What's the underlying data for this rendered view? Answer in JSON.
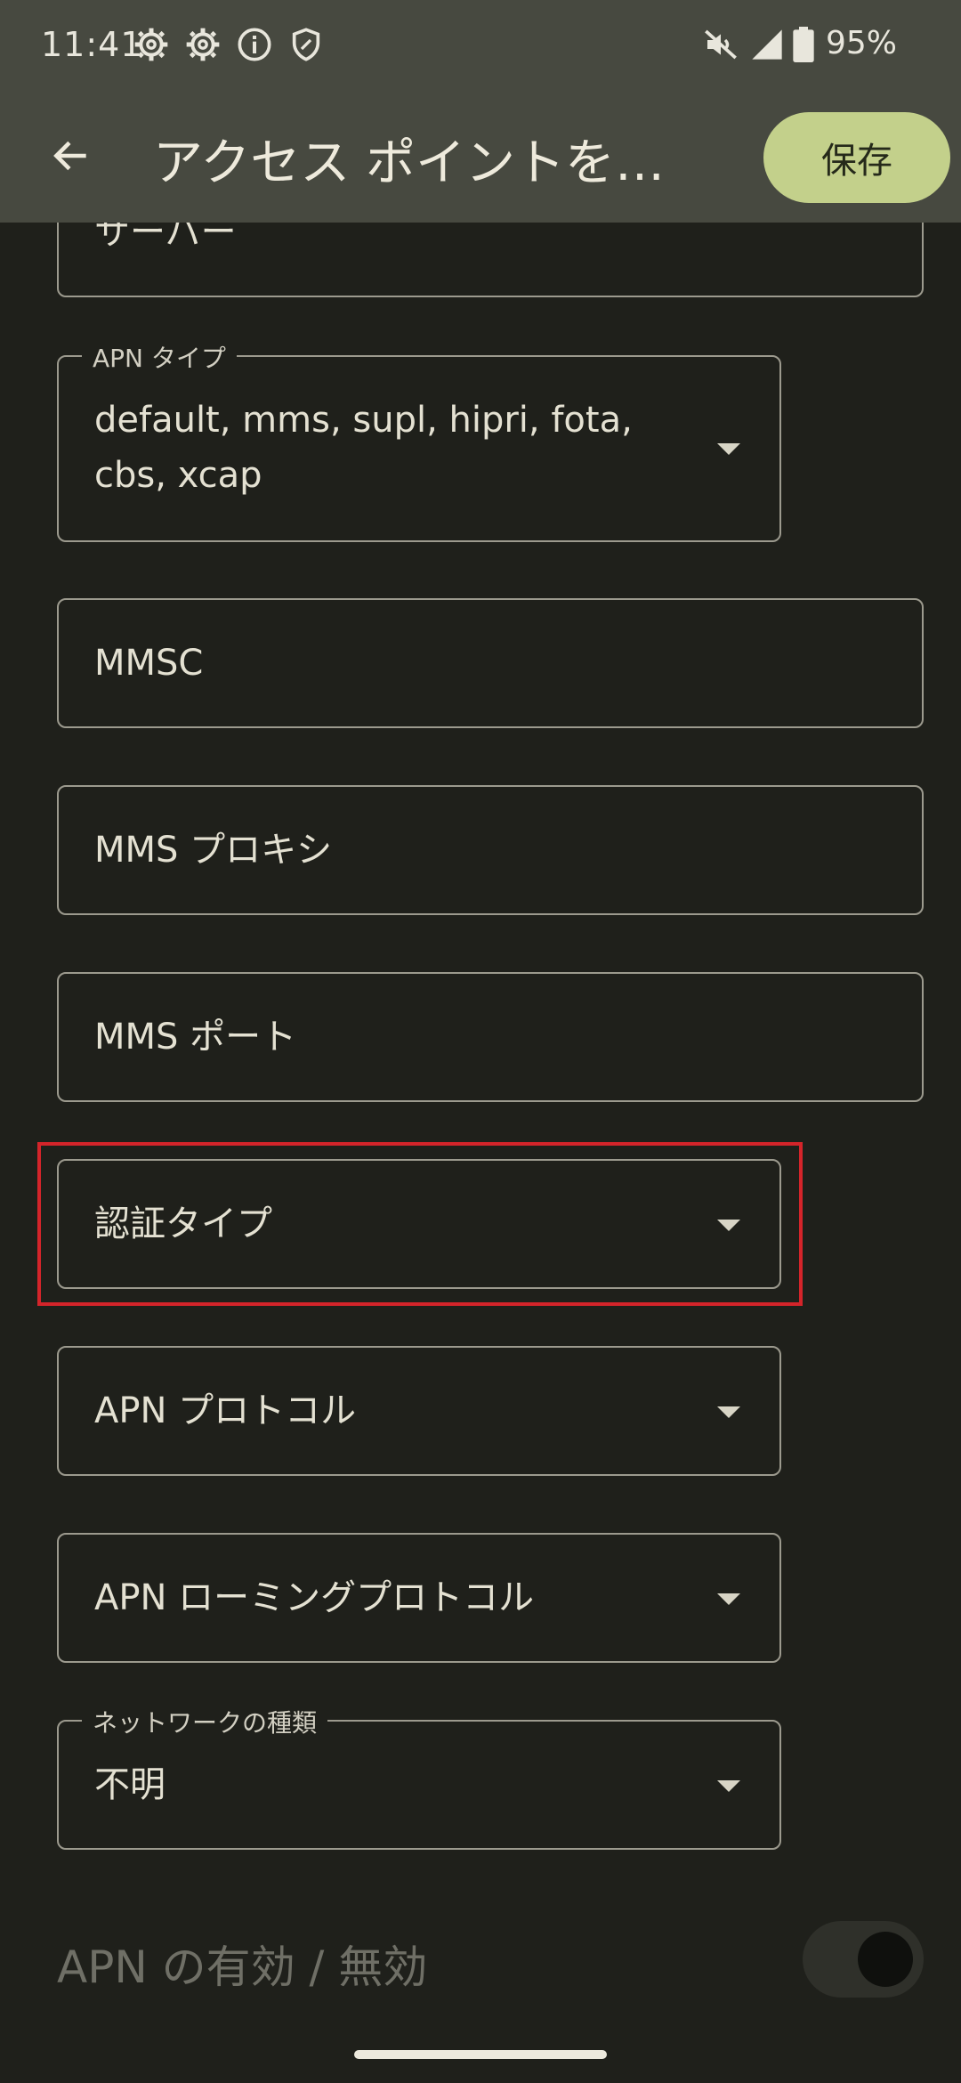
{
  "status_bar": {
    "time": "11:41",
    "left_icons": [
      "gear-icon",
      "gear-icon",
      "info-icon",
      "shield-icon"
    ],
    "right_icons": [
      "mute-icon",
      "signal-icon",
      "battery-icon"
    ],
    "battery": "95%"
  },
  "app_bar": {
    "back_icon": "arrow-left-icon",
    "title": "アクセス ポイントを…",
    "save_label": "保存"
  },
  "fields": {
    "server": {
      "text": "サーバー"
    },
    "apn_type": {
      "label": "APN タイプ",
      "line1": "default, mms, supl, hipri, fota,",
      "line2": "cbs, xcap"
    },
    "mmsc": {
      "text": "MMSC"
    },
    "mms_proxy": {
      "text": "MMS プロキシ"
    },
    "mms_port": {
      "text": "MMS ポート"
    },
    "auth_type": {
      "text": "認証タイプ"
    },
    "apn_protocol": {
      "text": "APN プロトコル"
    },
    "apn_roaming_protocol": {
      "text": "APN ローミングプロトコル"
    },
    "network_type": {
      "label": "ネットワークの種類",
      "value": "不明"
    }
  },
  "apn_toggle": {
    "label": "APN の有効 / 無効",
    "enabled": false
  },
  "colors": {
    "appbar": "#474940",
    "background": "#1f201b",
    "save_button": "#c3d08b",
    "highlight": "#d4242a"
  }
}
